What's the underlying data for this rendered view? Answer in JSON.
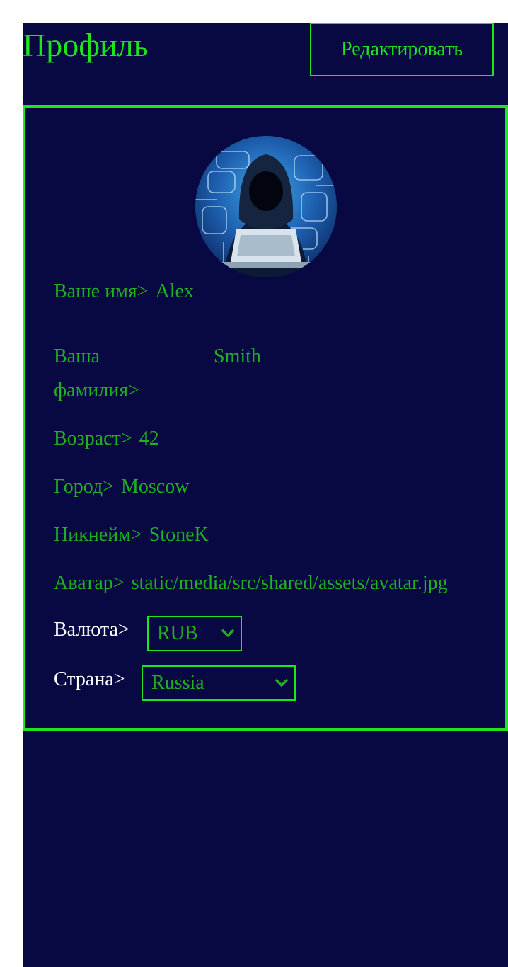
{
  "header": {
    "title": "Профиль",
    "edit_label": "Редактировать"
  },
  "profile": {
    "first_name": {
      "label": "Ваше имя>",
      "value": "Alex"
    },
    "last_name": {
      "label": "Ваша фамилия>",
      "value": "Smith"
    },
    "age": {
      "label": "Возраст>",
      "value": "42"
    },
    "city": {
      "label": "Город>",
      "value": "Moscow"
    },
    "nickname": {
      "label": "Никнейм>",
      "value": "StoneK"
    },
    "avatar": {
      "label": "Аватар>",
      "value": "static/media/src/shared/assets/avatar.jpg"
    },
    "currency": {
      "label": "Валюта>",
      "value": "RUB"
    },
    "country": {
      "label": "Страна>",
      "value": "Russia"
    }
  },
  "icons": {
    "avatar_image": "hacker-avatar",
    "select_arrow": "chevron-down-icon"
  },
  "colors": {
    "background": "#080842",
    "accent": "#1ee61e",
    "text": "#21b021",
    "label_white": "#ffffff"
  }
}
